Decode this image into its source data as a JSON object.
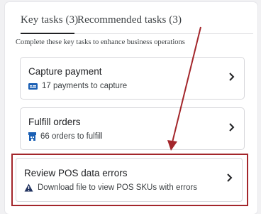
{
  "tabs": {
    "key_tasks": "Key tasks (3)",
    "recommended_tasks": "Recommended tasks (3)"
  },
  "subtitle": "Complete these key tasks to enhance business operations",
  "tasks": [
    {
      "title": "Capture payment",
      "detail": "17 payments to capture",
      "icon": "credit-card-icon"
    },
    {
      "title": "Fulfill orders",
      "detail": "66 orders to fulfill",
      "icon": "store-icon"
    },
    {
      "title": "Review POS data errors",
      "detail": "Download file to view POS SKUs with errors",
      "icon": "warning-icon"
    }
  ],
  "colors": {
    "annotation_red": "#a3262b",
    "icon_blue": "#1a5fb4",
    "warning_navy": "#20325f"
  }
}
